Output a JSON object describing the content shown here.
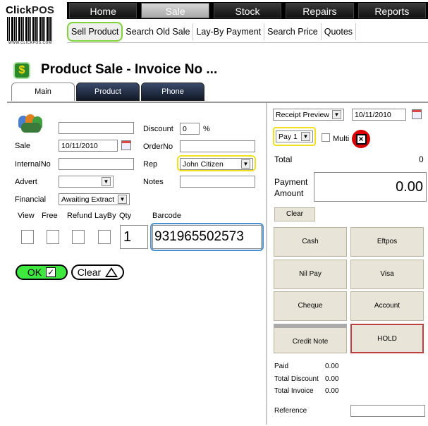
{
  "app": {
    "logo_primary": "Click",
    "logo_secondary": "POS",
    "logo_caption": "WWW.CLICKPOS.COM"
  },
  "topnav": [
    "Home",
    "Sale",
    "Stock",
    "Repairs",
    "Reports"
  ],
  "subnav": [
    "Sell Product",
    "Search Old Sale",
    "Lay-By Payment",
    "Search Price",
    "Quotes"
  ],
  "page": {
    "title": "Product Sale - Invoice No ...",
    "tabs": [
      "Main",
      "Product",
      "Phone"
    ]
  },
  "form": {
    "sale_label": "Sale",
    "sale_date": "10/11/2010",
    "internal_label": "InternalNo",
    "advert_label": "Advert",
    "financial_label": "Financial",
    "financial_value": "Awaiting Extract",
    "discount_label": "Discount",
    "discount_value": "0",
    "discount_unit": "%",
    "orderno_label": "OrderNo",
    "rep_label": "Rep",
    "rep_value": "John Citizen",
    "notes_label": "Notes",
    "col_view": "View",
    "col_free": "Free",
    "col_refund": "Refund",
    "col_layby": "LayBy",
    "col_qty": "Qty",
    "col_barcode": "Barcode",
    "qty_value": "1",
    "barcode_value": "931965502573",
    "ok_label": "OK",
    "clear_label": "Clear"
  },
  "right": {
    "receipt_value": "Receipt Preview",
    "receipt_date": "10/11/2010",
    "pay_value": "Pay 1",
    "multi_label": "Multi",
    "total_label": "Total",
    "total_value": "0",
    "payment_label_1": "Payment",
    "payment_label_2": "Amount",
    "payment_value": "0.00",
    "clear_label": "Clear",
    "buttons": [
      "Cash",
      "Eftpos",
      "Nil Pay",
      "Visa",
      "Cheque",
      "Account",
      "Credit Note",
      "HOLD"
    ],
    "paid_label": "Paid",
    "paid_value": "0.00",
    "total_discount_label": "Total Discount",
    "total_discount_value": "0.00",
    "total_invoice_label": "Total Invoice",
    "total_invoice_value": "0.00",
    "reference_label": "Reference"
  },
  "colors": {
    "highlight_green": "#7fd43a",
    "highlight_yellow": "#f0e020",
    "highlight_blue": "#4a90d0",
    "ok_green": "#3ee83e",
    "hold_border": "#c04040"
  }
}
